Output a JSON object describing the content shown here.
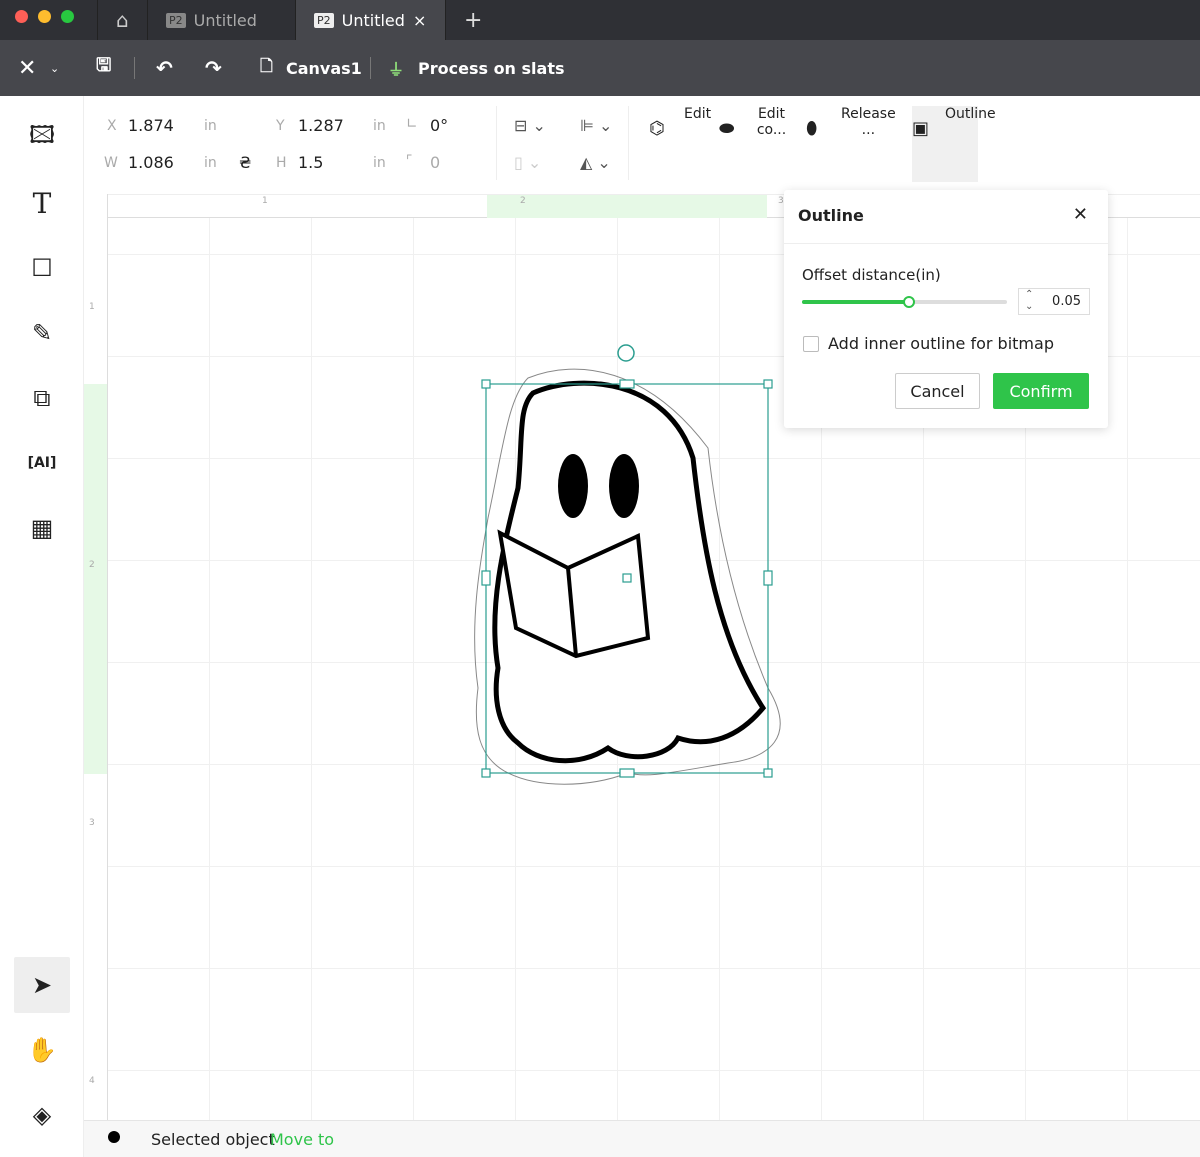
{
  "tabs": [
    {
      "badge": "P2",
      "label": "Untitled"
    },
    {
      "badge": "P2",
      "label": "Untitled",
      "close": "×"
    }
  ],
  "new_tab": "+",
  "toolbar": {
    "canvas": "Canvas1",
    "process": "Process on slats"
  },
  "props": {
    "x_label": "X",
    "x": "1.874",
    "y_label": "Y",
    "y": "1.287",
    "w_label": "W",
    "w": "1.086",
    "h_label": "H",
    "h": "1.5",
    "unit": "in",
    "angle": "0°",
    "radius": "0"
  },
  "tools": [
    {
      "label": "Edit"
    },
    {
      "label": "Edit co..."
    },
    {
      "label": "Release ..."
    },
    {
      "label": "Outline"
    }
  ],
  "ruler": {
    "h": [
      "1",
      "2",
      "3"
    ],
    "v": [
      "1",
      "2",
      "3",
      "4"
    ]
  },
  "outline_panel": {
    "title": "Outline",
    "offset_label": "Offset distance(in)",
    "offset_value": "0.05",
    "offset_fraction": 0.52,
    "checkbox_label": "Add inner outline for bitmap",
    "checked": false,
    "cancel": "Cancel",
    "confirm": "Confirm",
    "accent": "#2fc44a"
  },
  "status": {
    "text": "Selected object",
    "link": "Move to"
  }
}
